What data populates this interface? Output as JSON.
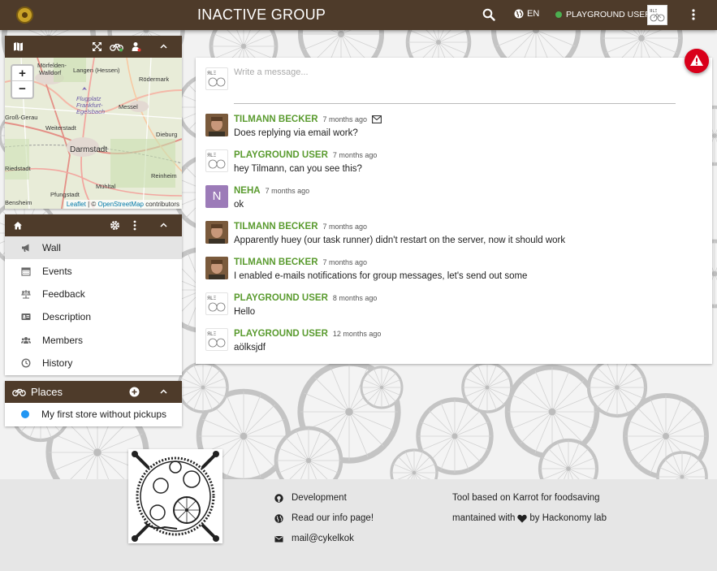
{
  "header": {
    "title": "INACTIVE GROUP",
    "language": "EN",
    "user": "PLAYGROUND USER",
    "colors": {
      "bar": "#4e3b2a",
      "online": "#4caf50"
    }
  },
  "map_panel": {
    "labels": [
      "Mörfelden-",
      "Walldorf",
      "Langen (Hessen)",
      "Rödermark",
      "Flugplatz",
      "Frankfurt-",
      "Egelsbach",
      "Messel",
      "Groß-Gerau",
      "Weiterstadt",
      "Dieburg",
      "Darmstadt",
      "Riedstadt",
      "Reinheim",
      "Mühltal",
      "Pfungstadt",
      "Bensheim"
    ],
    "attribution_leaflet": "Leaflet",
    "attribution_sep": " | © ",
    "attribution_osm": "OpenStreetMap",
    "attribution_tail": " contributors"
  },
  "group_menu": {
    "items": [
      {
        "label": "Wall",
        "icon": "bullhorn-icon",
        "active": true
      },
      {
        "label": "Events",
        "icon": "calendar-icon",
        "active": false
      },
      {
        "label": "Feedback",
        "icon": "balance-scale-icon",
        "active": false
      },
      {
        "label": "Description",
        "icon": "id-card-icon",
        "active": false
      },
      {
        "label": "Members",
        "icon": "users-icon",
        "active": false
      },
      {
        "label": "History",
        "icon": "clock-icon",
        "active": false
      }
    ]
  },
  "places": {
    "title": "Places",
    "items": [
      {
        "label": "My first store without pickups",
        "color": "#2196f3"
      }
    ]
  },
  "wall": {
    "placeholder": "Write a message...",
    "messages": [
      {
        "author": "TILMANN BECKER",
        "time": "7 months ago",
        "text": "Does replying via email work?",
        "avatar": "photo",
        "email_icon": true
      },
      {
        "author": "PLAYGROUND USER",
        "time": "7 months ago",
        "text": "hey Tilmann, can you see this?",
        "avatar": "playground",
        "email_icon": false
      },
      {
        "author": "NEHA",
        "time": "7 months ago",
        "text": "ok",
        "avatar": "letter",
        "avatar_letter": "N",
        "email_icon": false
      },
      {
        "author": "TILMANN BECKER",
        "time": "7 months ago",
        "text": "Apparently huey (our task runner) didn't restart on the server, now it should work",
        "avatar": "photo",
        "email_icon": false
      },
      {
        "author": "TILMANN BECKER",
        "time": "7 months ago",
        "text": "I enabled e-mails notifications for group messages, let's send out some",
        "avatar": "photo",
        "email_icon": false
      },
      {
        "author": "PLAYGROUND USER",
        "time": "8 months ago",
        "text": "Hello",
        "avatar": "playground",
        "email_icon": false
      },
      {
        "author": "PLAYGROUND USER",
        "time": "12 months ago",
        "text": "aölksjdf",
        "avatar": "playground",
        "email_icon": false
      }
    ],
    "author_color": "#5a9b2f"
  },
  "footer": {
    "development": "Development",
    "info": "Read our info page!",
    "mail": "mail@cykelkok",
    "tagline": "Tool based on Karrot for foodsaving",
    "maintained_pre": "mantained with",
    "maintained_post": "by Hackonomy lab"
  }
}
